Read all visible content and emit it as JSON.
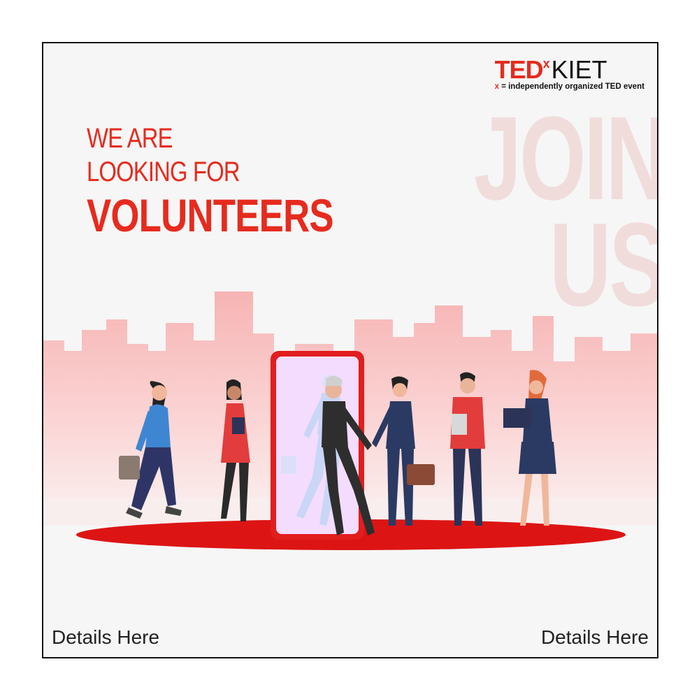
{
  "logo": {
    "ted": "TED",
    "x": "x",
    "kiet": "KIET",
    "tag_x": "x",
    "tag_eq": " = ",
    "tag_text": "independently organized TED event"
  },
  "background_words": {
    "join": "JOIN",
    "us": "US"
  },
  "headline": {
    "line1": "WE ARE",
    "line2": "LOOKING FOR",
    "line3": "VOLUNTEERS"
  },
  "footer": {
    "left": "Details Here",
    "right": "Details Here"
  },
  "colors": {
    "accent": "#e62b1e",
    "city": "#f7c9c9",
    "floor": "#dd1414",
    "phone_frame": "#e21d1d",
    "phone_screen": "#f4dcff"
  },
  "illustration": {
    "subject": "people-walking-through-phone-icon"
  }
}
